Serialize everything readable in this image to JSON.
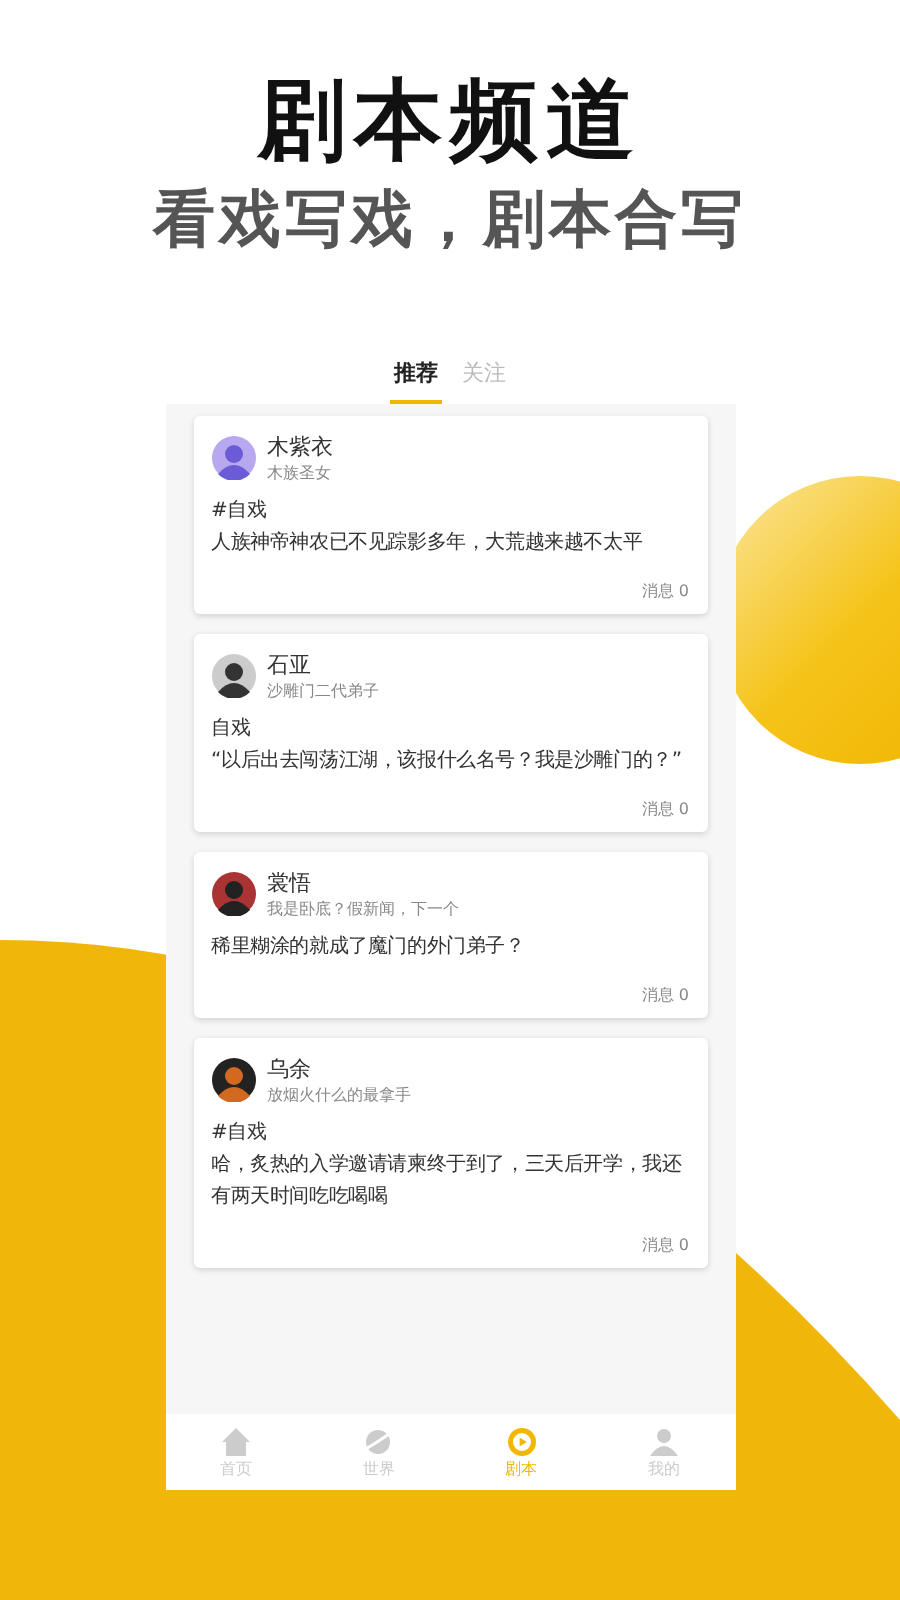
{
  "headline": "剧本频道",
  "subheadline": "看戏写戏，剧本合写",
  "tabs": [
    {
      "label": "推荐",
      "selected": true
    },
    {
      "label": "关注",
      "selected": false
    }
  ],
  "posts": [
    {
      "name": "木紫衣",
      "subtitle": "木族圣女",
      "tag": "#自戏",
      "text": "人族神帝神农已不见踪影多年，大荒越来越不太平",
      "count": "消息 0"
    },
    {
      "name": "石亚",
      "subtitle": "沙雕门二代弟子",
      "tag": "自戏",
      "text": "“以后出去闯荡江湖，该报什么名号？我是沙雕门的？”",
      "count": "消息 0"
    },
    {
      "name": "裳悟",
      "subtitle": "我是卧底？假新闻，下一个",
      "text": "稀里糊涂的就成了魔门的外门弟子？",
      "count": "消息 0"
    },
    {
      "name": "乌余",
      "subtitle": "放烟火什么的最拿手",
      "tag": "#自戏",
      "text": "哈，炙热的入学邀请请柬终于到了，三天后开学，我还有两天时间吃吃喝喝",
      "count": "消息 0"
    }
  ],
  "nav": [
    {
      "kind": "home",
      "label": "首页",
      "selected": false
    },
    {
      "kind": "planet",
      "label": "世界",
      "selected": false
    },
    {
      "kind": "play",
      "label": "剧本",
      "selected": true
    },
    {
      "kind": "person",
      "label": "我的",
      "selected": false
    }
  ]
}
